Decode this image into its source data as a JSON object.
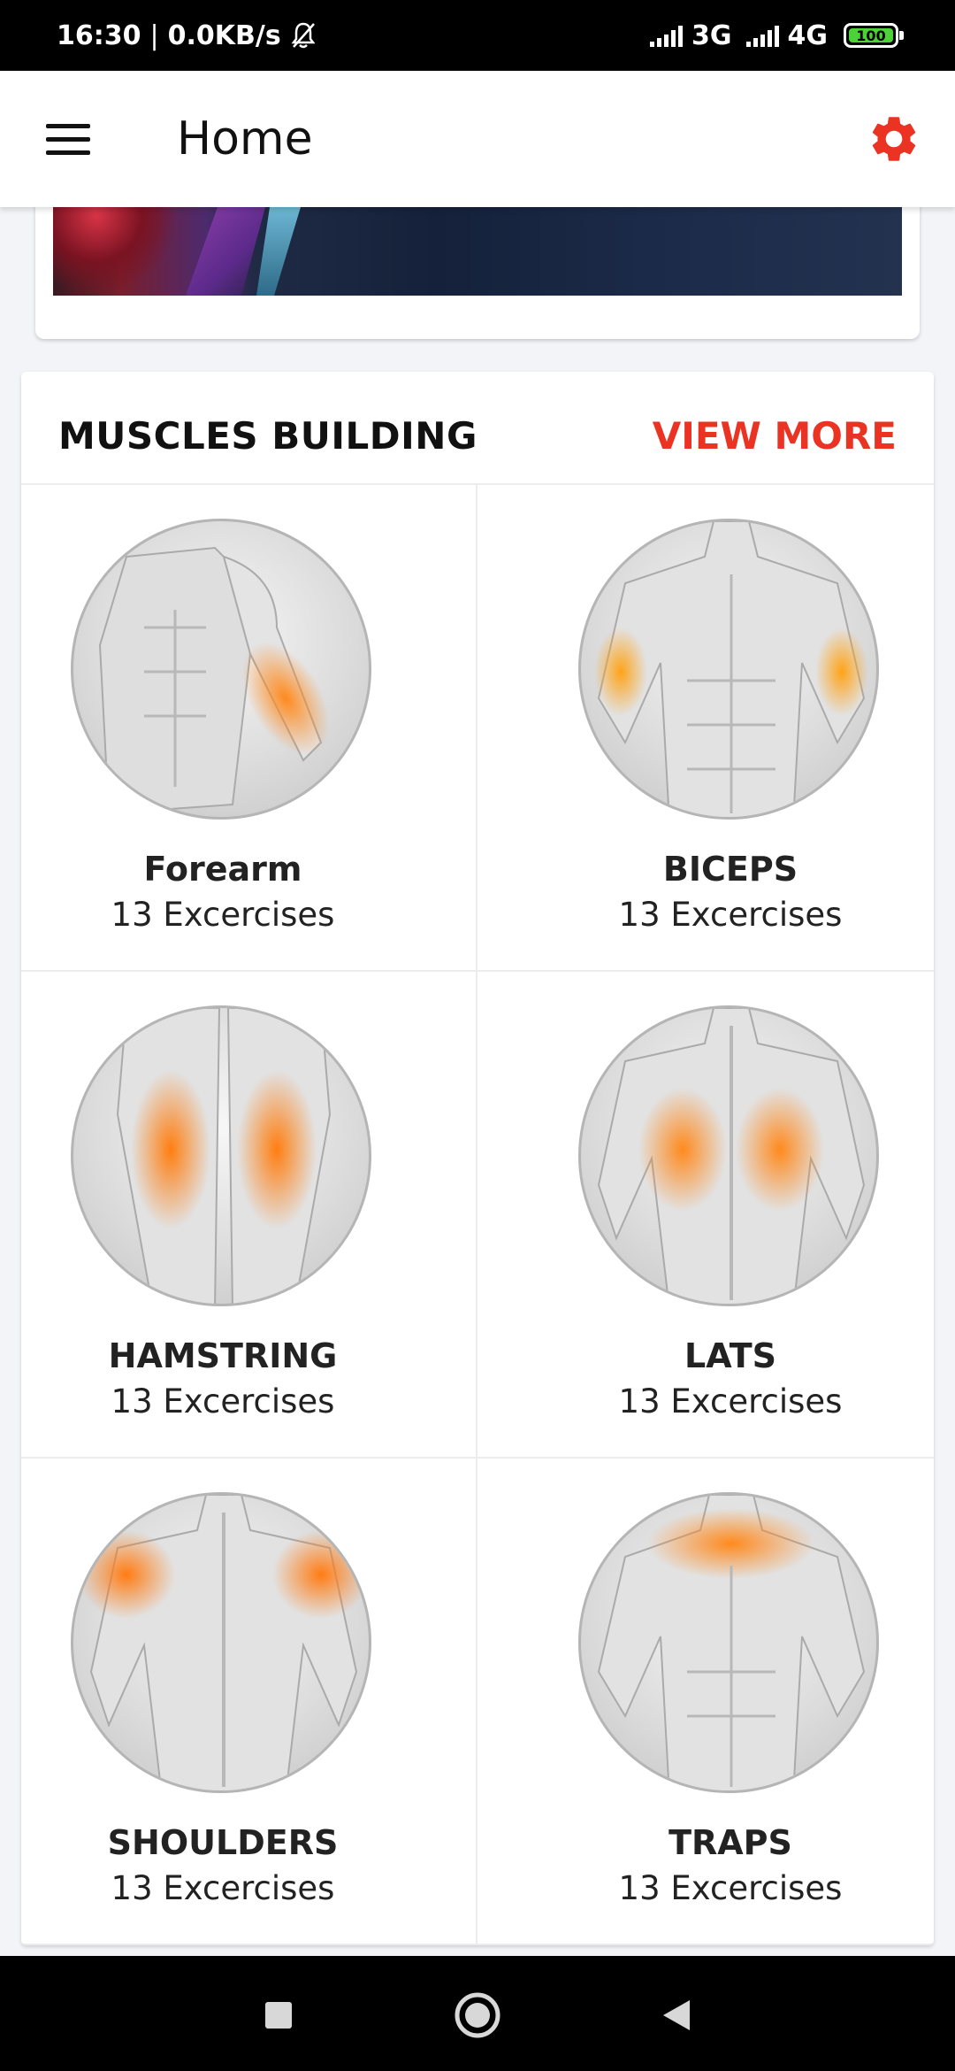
{
  "status_bar": {
    "time": "16:30",
    "speed": "0.0KB/s",
    "network1": "3G",
    "network2": "4G",
    "battery": "100"
  },
  "app_bar": {
    "title": "Home",
    "menu_icon": "hamburger-icon",
    "settings_icon": "gear-icon",
    "settings_color": "#ea3323"
  },
  "section": {
    "title": "MUSCLES BUILDING",
    "view_more": "VIEW MORE",
    "accent_color": "#ea3323"
  },
  "muscles": [
    {
      "name": "Forearm",
      "count": "13 Excercises",
      "highlight": "forearm"
    },
    {
      "name": "BICEPS",
      "count": "13 Excercises",
      "highlight": "biceps"
    },
    {
      "name": "HAMSTRING",
      "count": "13 Excercises",
      "highlight": "hamstring"
    },
    {
      "name": "LATS",
      "count": "13 Excercises",
      "highlight": "lats"
    },
    {
      "name": "SHOULDERS",
      "count": "13 Excercises",
      "highlight": "shoulders"
    },
    {
      "name": "TRAPS",
      "count": "13 Excercises",
      "highlight": "traps"
    }
  ],
  "nav_bar": {
    "recents_icon": "square-icon",
    "home_icon": "circle-home-icon",
    "back_icon": "triangle-back-icon"
  }
}
